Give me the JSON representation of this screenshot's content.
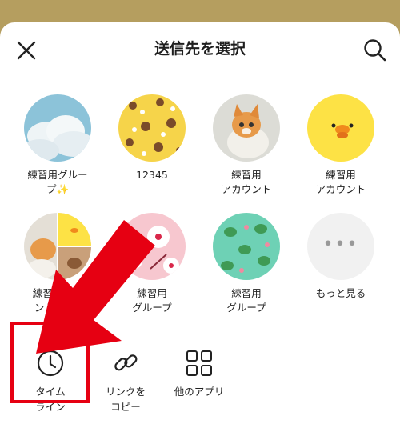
{
  "header": {
    "title": "送信先を選択"
  },
  "recipients": [
    {
      "label": "練習用グルー\nプ✨"
    },
    {
      "label": "12345"
    },
    {
      "label": "練習用\nアカウント"
    },
    {
      "label": "練習用\nアカウント"
    },
    {
      "label": "練習用アカ\nント, 練習"
    },
    {
      "label": "練習用\nグループ"
    },
    {
      "label": "練習用\nグループ"
    },
    {
      "label": "もっと見る"
    }
  ],
  "more_dots": "•••",
  "actions": [
    {
      "label": "タイム\nライン"
    },
    {
      "label": "リンクを\nコピー"
    },
    {
      "label": "他のアプリ"
    }
  ],
  "colors": {
    "highlight": "#e60012",
    "top_bar": "#b59e5f"
  }
}
